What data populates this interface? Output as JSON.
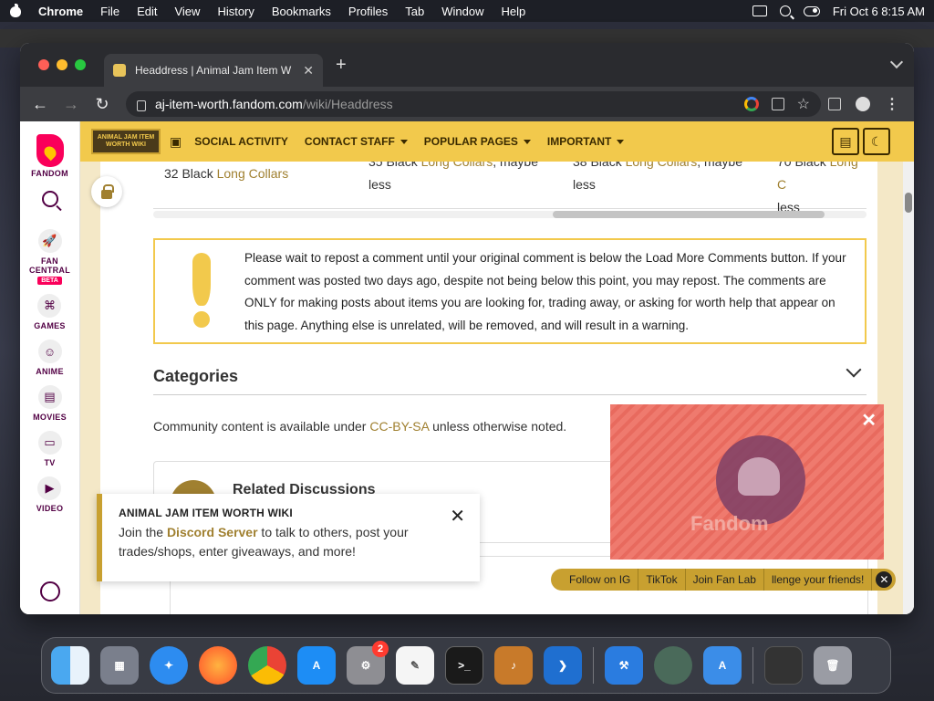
{
  "menubar": {
    "app": "Chrome",
    "items": [
      "File",
      "Edit",
      "View",
      "History",
      "Bookmarks",
      "Profiles",
      "Tab",
      "Window",
      "Help"
    ],
    "datetime": "Fri Oct 6  8:15 AM"
  },
  "browser": {
    "tab_title": "Headdress | Animal Jam Item W",
    "url_domain": "aj-item-worth.fandom.com",
    "url_path": "/wiki/Headdress"
  },
  "fandom_rail": {
    "brand": "FANDOM",
    "items": [
      {
        "label": "FAN CENTRAL",
        "badge": "BETA"
      },
      {
        "label": "GAMES"
      },
      {
        "label": "ANIME"
      },
      {
        "label": "MOVIES"
      },
      {
        "label": "TV"
      },
      {
        "label": "VIDEO"
      }
    ]
  },
  "wiki_nav": {
    "logo_text": "ANIMAL JAM ITEM WORTH WIKI",
    "items": [
      "SOCIAL ACTIVITY",
      "CONTACT STAFF",
      "POPULAR PAGES",
      "IMPORTANT"
    ]
  },
  "table_row": {
    "cells": [
      {
        "pre": "32 Black ",
        "link": "Long Collars",
        "post": ""
      },
      {
        "pre": "35 Black ",
        "link": "Long Collars",
        "post": ", maybe less"
      },
      {
        "pre": "38 Black ",
        "link": "Long Collars",
        "post": ", maybe less"
      },
      {
        "pre": "70 Black ",
        "link": "Long C",
        "post": "less"
      }
    ]
  },
  "notice": {
    "text": "Please wait to repost a comment until your original comment is below the Load More Comments button. If your comment was posted two days ago, despite not being below this point, you may repost. The comments are ONLY for making posts about items you are looking for, trading away, or asking for worth help that appear on this page. Anything else is unrelated, will be removed, and will result in a warning."
  },
  "categories": {
    "heading": "Categories"
  },
  "license": {
    "pre": "Community content is available under ",
    "link": "CC-BY-SA",
    "post": " unless otherwise noted."
  },
  "related": {
    "title": "Related Discussions"
  },
  "toast": {
    "title": "ANIMAL JAM ITEM WORTH WIKI",
    "body_pre": "Join the ",
    "body_link": "Discord Server",
    "body_post": " to talk to others, post your trades/shops, enter giveaways, and more!"
  },
  "ad": {
    "watermark": "Fandom"
  },
  "social": {
    "items": [
      "Follow on IG",
      "TikTok",
      "Join Fan Lab",
      "llenge your friends!"
    ]
  },
  "dock": {
    "apps": [
      "finder",
      "launchpad",
      "safari",
      "firefox",
      "chrome",
      "app-store",
      "system-settings",
      "textedit",
      "terminal",
      "garageband",
      "vscode",
      "xcode",
      "preview",
      "simulator",
      "screen-capture",
      "trash"
    ],
    "system_settings_badge": "2"
  },
  "colors": {
    "wiki_accent": "#f2c94c",
    "link": "#a08030",
    "fandom_pink": "#fa005a"
  }
}
